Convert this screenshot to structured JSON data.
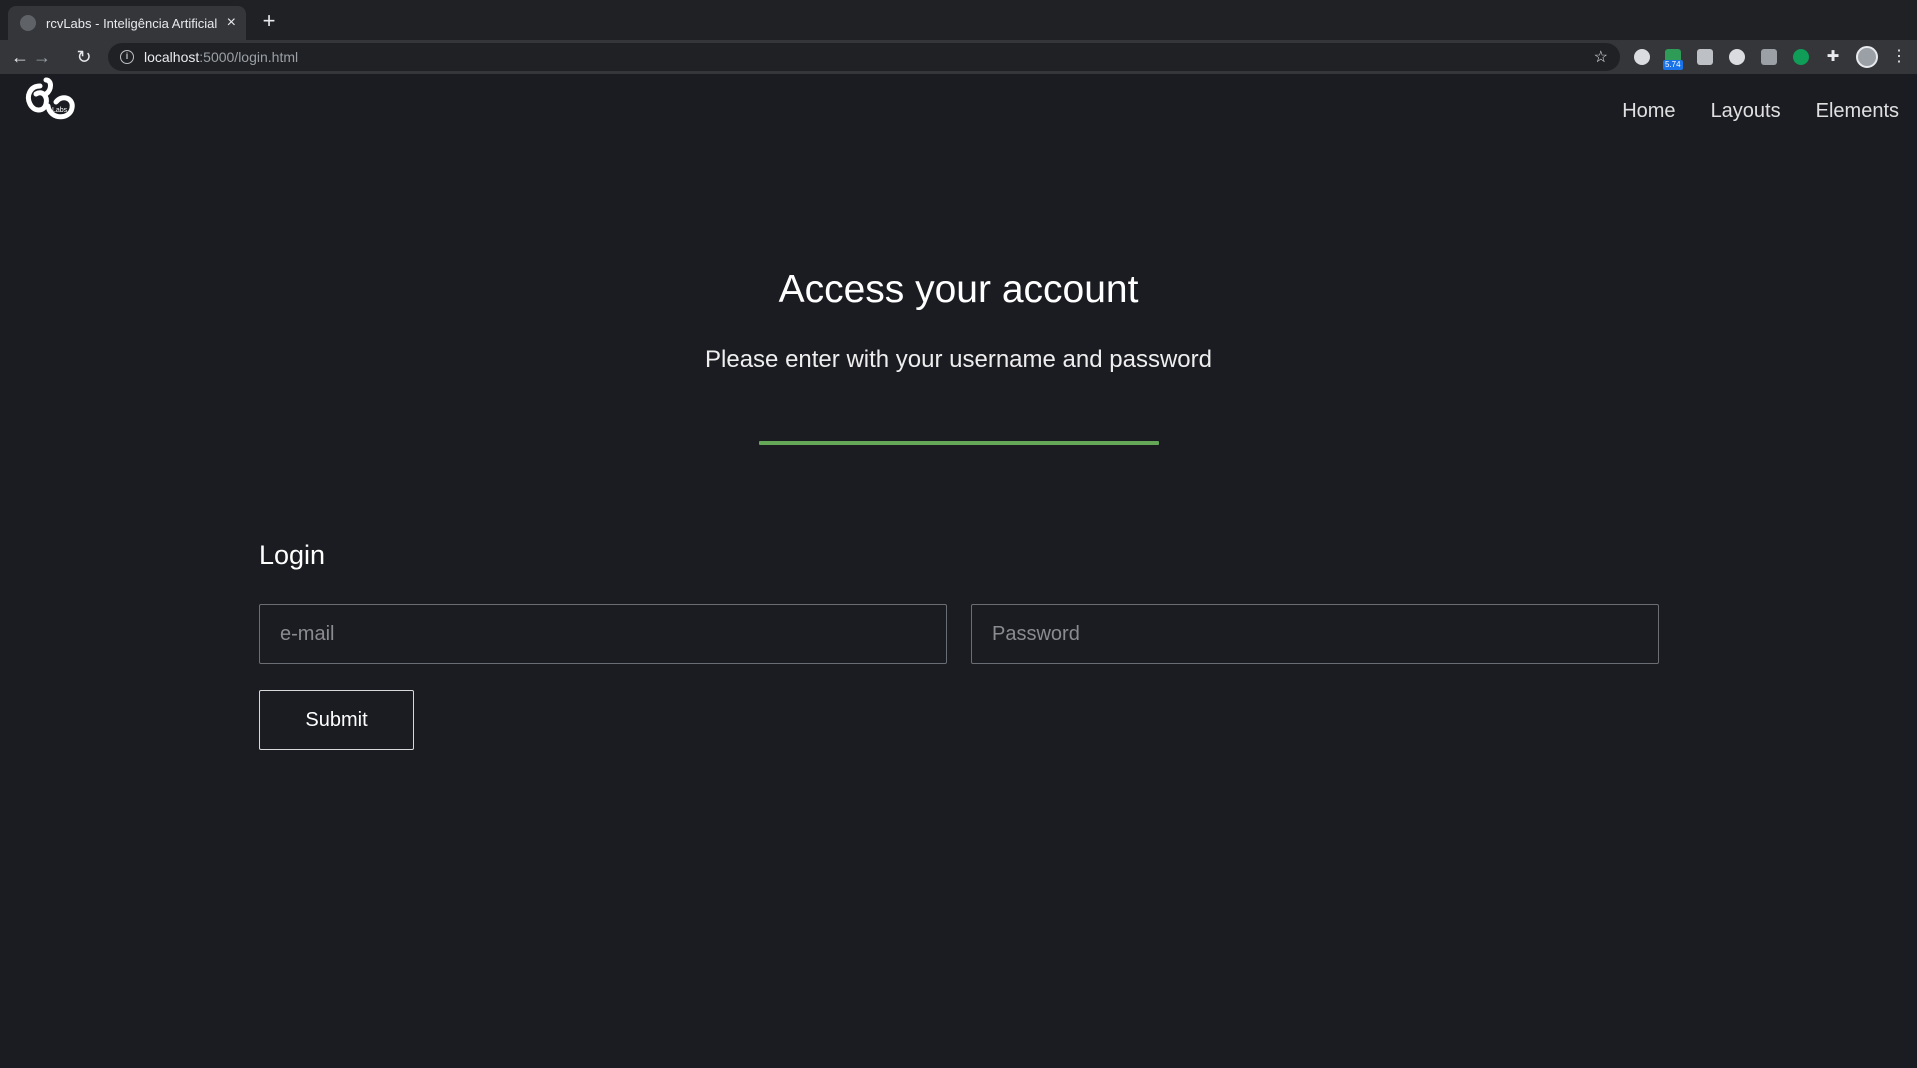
{
  "browser": {
    "tab_title": "rcvLabs - Inteligência Artificial",
    "url_host": "localhost",
    "url_path": ":5000/login.html",
    "extension_badge": "5.74"
  },
  "header": {
    "logo_text": "Labs",
    "nav": [
      {
        "label": "Home"
      },
      {
        "label": "Layouts"
      },
      {
        "label": "Elements"
      }
    ]
  },
  "hero": {
    "title": "Access your account",
    "subtitle": "Please enter with your username and password",
    "divider_color": "#64a857"
  },
  "login": {
    "heading": "Login",
    "email_placeholder": "e-mail",
    "password_placeholder": "Password",
    "submit_label": "Submit"
  }
}
